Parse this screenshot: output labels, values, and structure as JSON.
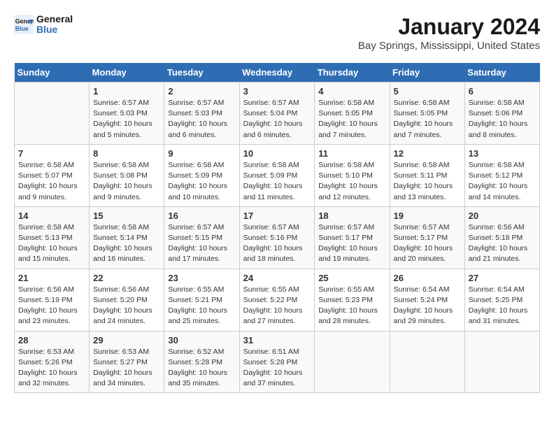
{
  "logo": {
    "line1": "General",
    "line2": "Blue"
  },
  "title": "January 2024",
  "subtitle": "Bay Springs, Mississippi, United States",
  "days_of_week": [
    "Sunday",
    "Monday",
    "Tuesday",
    "Wednesday",
    "Thursday",
    "Friday",
    "Saturday"
  ],
  "weeks": [
    [
      {
        "day": "",
        "info": ""
      },
      {
        "day": "1",
        "info": "Sunrise: 6:57 AM\nSunset: 5:03 PM\nDaylight: 10 hours\nand 5 minutes."
      },
      {
        "day": "2",
        "info": "Sunrise: 6:57 AM\nSunset: 5:03 PM\nDaylight: 10 hours\nand 6 minutes."
      },
      {
        "day": "3",
        "info": "Sunrise: 6:57 AM\nSunset: 5:04 PM\nDaylight: 10 hours\nand 6 minutes."
      },
      {
        "day": "4",
        "info": "Sunrise: 6:58 AM\nSunset: 5:05 PM\nDaylight: 10 hours\nand 7 minutes."
      },
      {
        "day": "5",
        "info": "Sunrise: 6:58 AM\nSunset: 5:05 PM\nDaylight: 10 hours\nand 7 minutes."
      },
      {
        "day": "6",
        "info": "Sunrise: 6:58 AM\nSunset: 5:06 PM\nDaylight: 10 hours\nand 8 minutes."
      }
    ],
    [
      {
        "day": "7",
        "info": "Sunrise: 6:58 AM\nSunset: 5:07 PM\nDaylight: 10 hours\nand 9 minutes."
      },
      {
        "day": "8",
        "info": "Sunrise: 6:58 AM\nSunset: 5:08 PM\nDaylight: 10 hours\nand 9 minutes."
      },
      {
        "day": "9",
        "info": "Sunrise: 6:58 AM\nSunset: 5:09 PM\nDaylight: 10 hours\nand 10 minutes."
      },
      {
        "day": "10",
        "info": "Sunrise: 6:58 AM\nSunset: 5:09 PM\nDaylight: 10 hours\nand 11 minutes."
      },
      {
        "day": "11",
        "info": "Sunrise: 6:58 AM\nSunset: 5:10 PM\nDaylight: 10 hours\nand 12 minutes."
      },
      {
        "day": "12",
        "info": "Sunrise: 6:58 AM\nSunset: 5:11 PM\nDaylight: 10 hours\nand 13 minutes."
      },
      {
        "day": "13",
        "info": "Sunrise: 6:58 AM\nSunset: 5:12 PM\nDaylight: 10 hours\nand 14 minutes."
      }
    ],
    [
      {
        "day": "14",
        "info": "Sunrise: 6:58 AM\nSunset: 5:13 PM\nDaylight: 10 hours\nand 15 minutes."
      },
      {
        "day": "15",
        "info": "Sunrise: 6:58 AM\nSunset: 5:14 PM\nDaylight: 10 hours\nand 16 minutes."
      },
      {
        "day": "16",
        "info": "Sunrise: 6:57 AM\nSunset: 5:15 PM\nDaylight: 10 hours\nand 17 minutes."
      },
      {
        "day": "17",
        "info": "Sunrise: 6:57 AM\nSunset: 5:16 PM\nDaylight: 10 hours\nand 18 minutes."
      },
      {
        "day": "18",
        "info": "Sunrise: 6:57 AM\nSunset: 5:17 PM\nDaylight: 10 hours\nand 19 minutes."
      },
      {
        "day": "19",
        "info": "Sunrise: 6:57 AM\nSunset: 5:17 PM\nDaylight: 10 hours\nand 20 minutes."
      },
      {
        "day": "20",
        "info": "Sunrise: 6:56 AM\nSunset: 5:18 PM\nDaylight: 10 hours\nand 21 minutes."
      }
    ],
    [
      {
        "day": "21",
        "info": "Sunrise: 6:56 AM\nSunset: 5:19 PM\nDaylight: 10 hours\nand 23 minutes."
      },
      {
        "day": "22",
        "info": "Sunrise: 6:56 AM\nSunset: 5:20 PM\nDaylight: 10 hours\nand 24 minutes."
      },
      {
        "day": "23",
        "info": "Sunrise: 6:55 AM\nSunset: 5:21 PM\nDaylight: 10 hours\nand 25 minutes."
      },
      {
        "day": "24",
        "info": "Sunrise: 6:55 AM\nSunset: 5:22 PM\nDaylight: 10 hours\nand 27 minutes."
      },
      {
        "day": "25",
        "info": "Sunrise: 6:55 AM\nSunset: 5:23 PM\nDaylight: 10 hours\nand 28 minutes."
      },
      {
        "day": "26",
        "info": "Sunrise: 6:54 AM\nSunset: 5:24 PM\nDaylight: 10 hours\nand 29 minutes."
      },
      {
        "day": "27",
        "info": "Sunrise: 6:54 AM\nSunset: 5:25 PM\nDaylight: 10 hours\nand 31 minutes."
      }
    ],
    [
      {
        "day": "28",
        "info": "Sunrise: 6:53 AM\nSunset: 5:26 PM\nDaylight: 10 hours\nand 32 minutes."
      },
      {
        "day": "29",
        "info": "Sunrise: 6:53 AM\nSunset: 5:27 PM\nDaylight: 10 hours\nand 34 minutes."
      },
      {
        "day": "30",
        "info": "Sunrise: 6:52 AM\nSunset: 5:28 PM\nDaylight: 10 hours\nand 35 minutes."
      },
      {
        "day": "31",
        "info": "Sunrise: 6:51 AM\nSunset: 5:28 PM\nDaylight: 10 hours\nand 37 minutes."
      },
      {
        "day": "",
        "info": ""
      },
      {
        "day": "",
        "info": ""
      },
      {
        "day": "",
        "info": ""
      }
    ]
  ]
}
